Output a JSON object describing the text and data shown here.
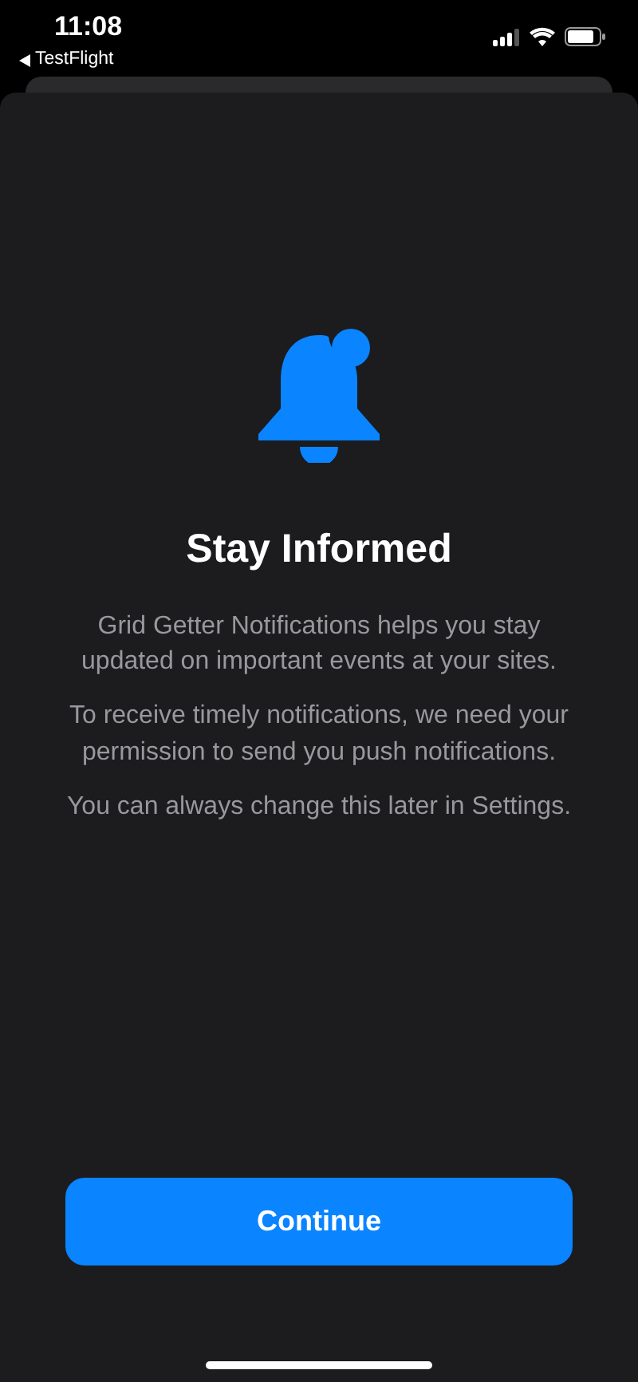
{
  "status_bar": {
    "time": "11:08",
    "back_label": "TestFlight"
  },
  "title": "Stay Informed",
  "paragraphs": [
    "Grid Getter Notifications helps you stay updated on important events at your sites.",
    "To receive timely notifications, we need your permission to send you push notifications.",
    "You can always change this later in Settings."
  ],
  "button": {
    "label": "Continue"
  }
}
